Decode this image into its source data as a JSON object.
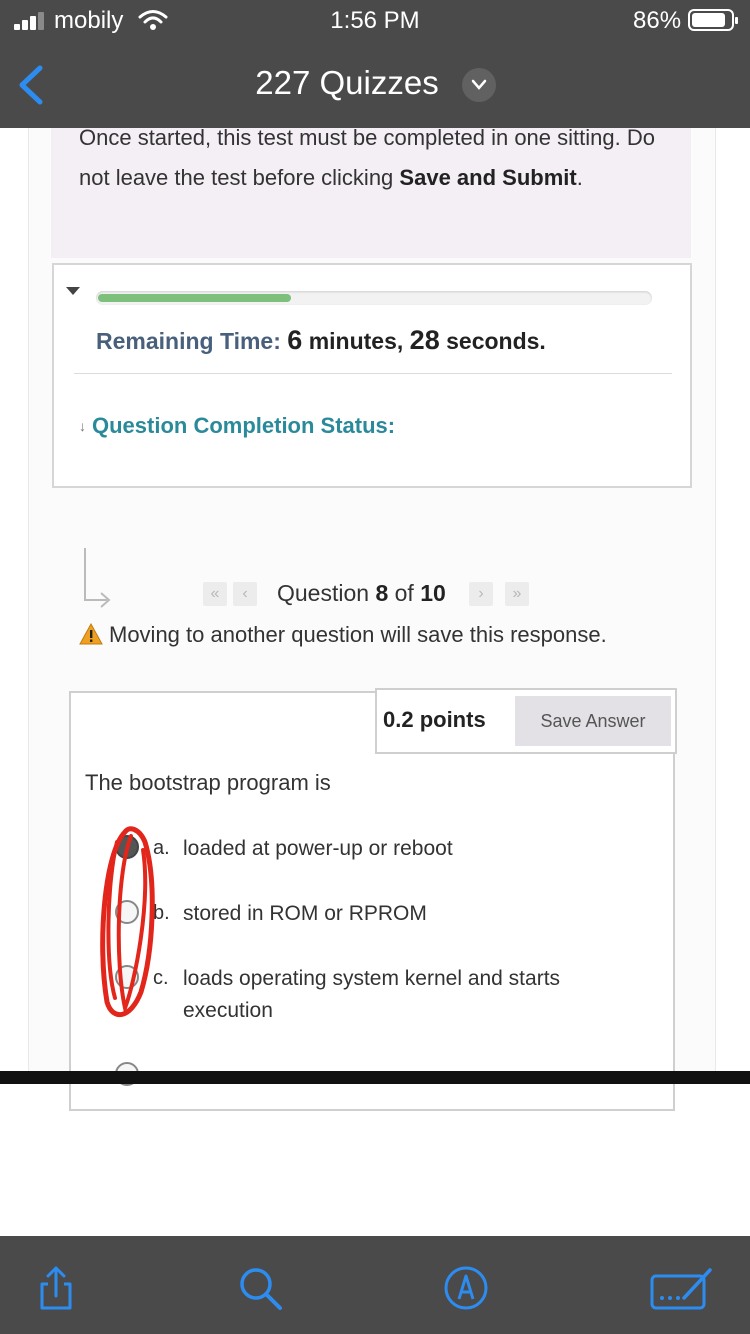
{
  "status_bar": {
    "carrier": "mobily",
    "time": "1:56 PM",
    "battery": "86%",
    "battery_level": 0.86
  },
  "nav": {
    "title": "227 Quizzes",
    "back_icon": "chevron-left-icon",
    "menu_icon": "chevron-down-icon"
  },
  "notice": {
    "text": "Once started, this test must be completed in one sitting. Do not leave the test before clicking ",
    "bold": "Save and Submit",
    "end": "."
  },
  "timer": {
    "label": "Remaining Time:",
    "minutes": "6",
    "minutes_unit": " minutes, ",
    "seconds": "28",
    "seconds_unit": " seconds.",
    "progress": 0.35,
    "progress_color": "#7cc07c"
  },
  "completion": {
    "label": "Question Completion Status:"
  },
  "question_nav": {
    "first_icon": "«",
    "prev_icon": "‹",
    "next_icon": "›",
    "last_icon": "»",
    "prefix": "Question ",
    "current": "8",
    "of": " of ",
    "total": "10"
  },
  "move_warning": "Moving to another question will save this response.",
  "question": {
    "points": "0.2 points",
    "save_label": "Save Answer",
    "text": "The bootstrap program is",
    "options": [
      {
        "letter": "a.",
        "text": "loaded at power-up or reboot",
        "selected": true
      },
      {
        "letter": "b.",
        "text": "stored in ROM or RPROM",
        "selected": false
      },
      {
        "letter": "c.",
        "text": "loads operating system kernel and starts execution",
        "selected": false
      }
    ]
  },
  "colors": {
    "bar_bg": "#4a4a4a",
    "link_blue": "#2d8cf0",
    "scribble_red": "#e2261b",
    "teal": "#2a8a9a"
  }
}
